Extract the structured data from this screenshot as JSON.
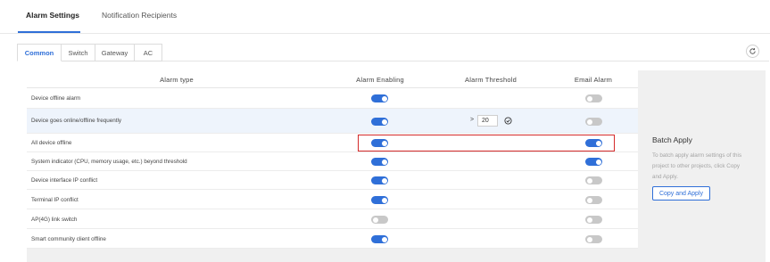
{
  "top_tabs": [
    {
      "label": "Alarm Settings",
      "active": true
    },
    {
      "label": "Notification Recipients",
      "active": false
    }
  ],
  "sub_tabs": [
    {
      "label": "Common",
      "active": true
    },
    {
      "label": "Switch",
      "active": false
    },
    {
      "label": "Gateway",
      "active": false
    },
    {
      "label": "AC",
      "active": false
    }
  ],
  "table": {
    "headers": {
      "alarm_type": "Alarm type",
      "alarm_enabling": "Alarm Enabling",
      "alarm_threshold": "Alarm Threshold",
      "email_alarm": "Email Alarm"
    },
    "rows": [
      {
        "name": "Device offline alarm",
        "enabled": true,
        "email": false
      },
      {
        "name": "Device goes online/offline frequently",
        "enabled": true,
        "email": false,
        "threshold": {
          "operator": ">",
          "value": "20"
        }
      },
      {
        "name": "All device offline",
        "enabled": true,
        "email": true
      },
      {
        "name": "System indicator (CPU, memory usage, etc.) beyond threshold",
        "enabled": true,
        "email": true
      },
      {
        "name": "Device interface IP conflict",
        "enabled": true,
        "email": false
      },
      {
        "name": "Terminal IP conflict",
        "enabled": true,
        "email": false
      },
      {
        "name": "AP(4G) link switch",
        "enabled": false,
        "email": false
      },
      {
        "name": "Smart community client offline",
        "enabled": true,
        "email": false
      }
    ]
  },
  "batch_apply": {
    "title": "Batch Apply",
    "description": "To batch apply alarm settings of this project to other projects, click Copy and Apply.",
    "button_label": "Copy and Apply"
  },
  "colors": {
    "accent": "#2f6fd8",
    "toggle_off": "#c8c8c8",
    "highlight_border": "#d42a2a",
    "row_highlight": "#eef4fc"
  }
}
